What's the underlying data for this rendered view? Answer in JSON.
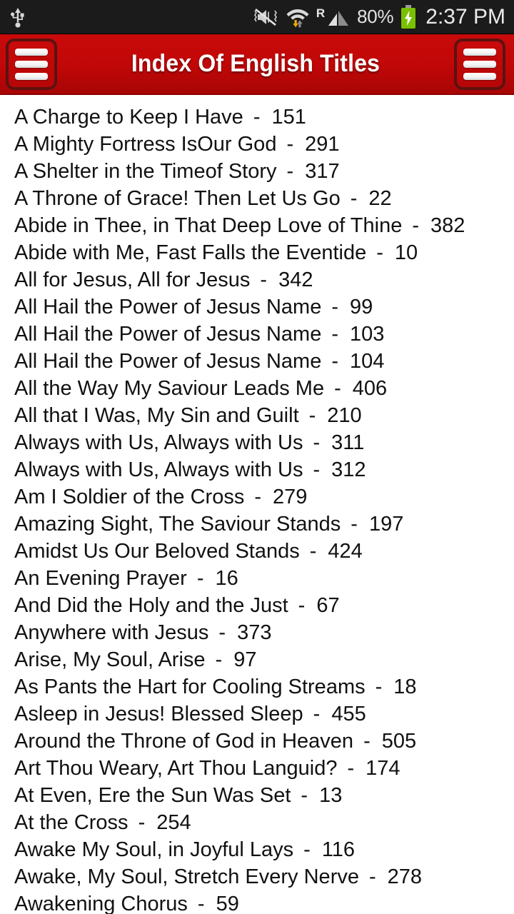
{
  "statusbar": {
    "icons": [
      "usb-icon",
      "sound-mute-vibrate-icon",
      "wifi-transfer-icon",
      "roaming-icon",
      "signal-bars-icon",
      "battery-charging-icon"
    ],
    "roaming_label": "R",
    "battery_percent": "80%",
    "time": "2:37 PM",
    "background_color": "#1b1b1b",
    "battery_color": "#7ac000"
  },
  "appbar": {
    "title": "Index Of English Titles",
    "left_menu_label": "menu",
    "right_menu_label": "menu",
    "background_color": "#c00707",
    "title_color": "#ffffff"
  },
  "list": {
    "separator": "-",
    "items": [
      {
        "title": "A Charge to Keep I Have",
        "number": "151"
      },
      {
        "title": "A Mighty Fortress IsOur God",
        "number": "291"
      },
      {
        "title": "A Shelter in the Timeof Story",
        "number": "317"
      },
      {
        "title": "A Throne of Grace! Then Let Us Go",
        "number": "22"
      },
      {
        "title": "Abide in Thee, in That Deep Love of Thine",
        "number": "382"
      },
      {
        "title": "Abide with Me, Fast Falls the Eventide",
        "number": "10"
      },
      {
        "title": "All for Jesus, All for Jesus",
        "number": "342"
      },
      {
        "title": "All Hail the Power of Jesus Name",
        "number": "99"
      },
      {
        "title": "All Hail the Power of Jesus Name",
        "number": "103"
      },
      {
        "title": "All Hail the Power of Jesus Name",
        "number": "104"
      },
      {
        "title": "All the Way My Saviour Leads Me",
        "number": "406"
      },
      {
        "title": "All that I Was, My Sin and Guilt",
        "number": "210"
      },
      {
        "title": "Always with Us, Always with Us",
        "number": "311"
      },
      {
        "title": "Always with Us, Always with Us",
        "number": "312"
      },
      {
        "title": "Am I Soldier of the Cross",
        "number": "279"
      },
      {
        "title": "Amazing Sight, The Saviour Stands",
        "number": "197"
      },
      {
        "title": "Amidst Us Our Beloved Stands",
        "number": "424"
      },
      {
        "title": "An Evening Prayer",
        "number": "16"
      },
      {
        "title": "And Did the Holy and the Just",
        "number": "67"
      },
      {
        "title": "Anywhere with Jesus",
        "number": "373"
      },
      {
        "title": "Arise, My Soul, Arise",
        "number": "97"
      },
      {
        "title": "As Pants the Hart for Cooling Streams",
        "number": "18"
      },
      {
        "title": "Asleep in Jesus! Blessed Sleep",
        "number": "455"
      },
      {
        "title": "Around the Throne of God in Heaven",
        "number": "505"
      },
      {
        "title": "Art Thou Weary, Art Thou Languid?",
        "number": "174"
      },
      {
        "title": "At Even, Ere the Sun Was Set",
        "number": "13"
      },
      {
        "title": "At the Cross",
        "number": "254"
      },
      {
        "title": "Awake My Soul, in Joyful Lays",
        "number": "116"
      },
      {
        "title": "Awake, My Soul, Stretch Every Nerve",
        "number": "278"
      },
      {
        "title": "Awakening Chorus",
        "number": "59"
      }
    ]
  }
}
